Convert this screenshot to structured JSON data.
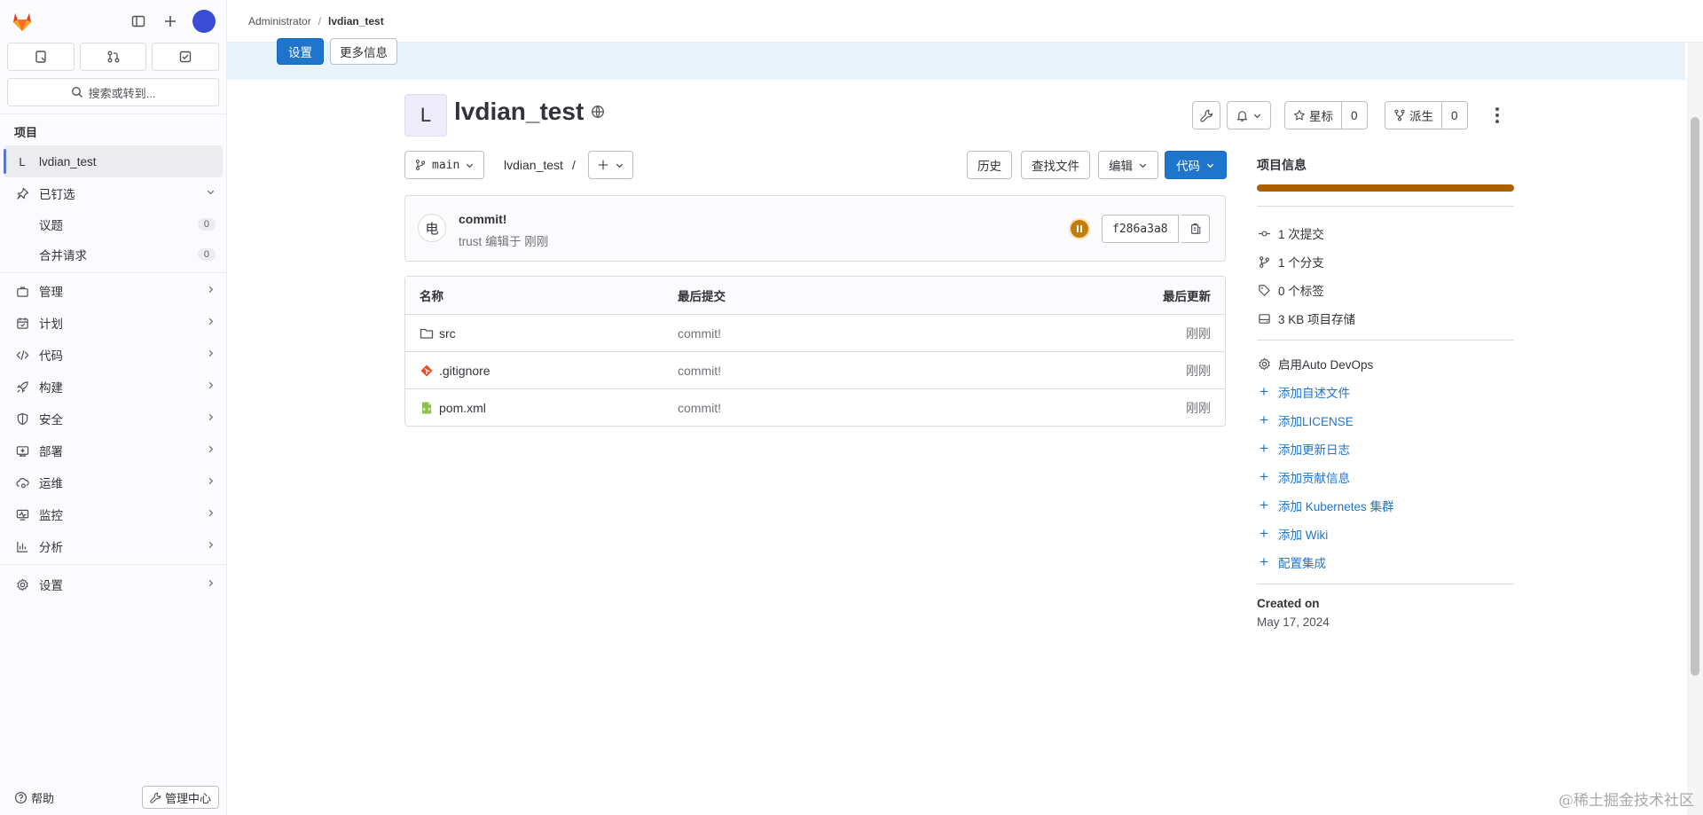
{
  "sidebar": {
    "search_placeholder": "搜索或转到...",
    "section_title": "项目",
    "project_letter": "L",
    "project_name": "lvdian_test",
    "pinned_label": "已钉选",
    "pinned_items": [
      {
        "label": "议题",
        "count": "0"
      },
      {
        "label": "合并请求",
        "count": "0"
      }
    ],
    "nav_items": [
      {
        "label": "管理",
        "icon": "briefcase-icon"
      },
      {
        "label": "计划",
        "icon": "calendar-icon"
      },
      {
        "label": "代码",
        "icon": "code-icon"
      },
      {
        "label": "构建",
        "icon": "rocket-icon"
      },
      {
        "label": "安全",
        "icon": "shield-icon"
      },
      {
        "label": "部署",
        "icon": "deployments-icon"
      },
      {
        "label": "运维",
        "icon": "cloud-gear-icon"
      },
      {
        "label": "监控",
        "icon": "monitor-icon"
      },
      {
        "label": "分析",
        "icon": "chart-icon"
      }
    ],
    "settings_label": "设置",
    "help_label": "帮助",
    "admin_label": "管理中心"
  },
  "breadcrumb": {
    "parent": "Administrator",
    "current": "lvdian_test"
  },
  "banner": {
    "settings_label": "设置",
    "more_info_label": "更多信息"
  },
  "project": {
    "avatar_letter": "L",
    "name": "lvdian_test",
    "notifications_icon": "bell-icon",
    "star_label": "星标",
    "star_count": "0",
    "fork_label": "派生",
    "fork_count": "0"
  },
  "repo": {
    "branch": "main",
    "path": "lvdian_test",
    "path_sep": "/",
    "history_label": "历史",
    "find_file_label": "查找文件",
    "edit_label": "编辑",
    "code_label": "代码"
  },
  "commit": {
    "avatar_text": "电",
    "title": "commit!",
    "meta": "trust 编辑于 刚刚",
    "sha": "f286a3a8",
    "status_color": "#c17d10"
  },
  "files": {
    "headers": {
      "name": "名称",
      "last_commit": "最后提交",
      "last_update": "最后更新"
    },
    "rows": [
      {
        "name": "src",
        "icon": "folder-icon",
        "commit": "commit!",
        "date": "刚刚"
      },
      {
        "name": ".gitignore",
        "icon": "git-icon",
        "commit": "commit!",
        "date": "刚刚"
      },
      {
        "name": "pom.xml",
        "icon": "xml-file-icon",
        "commit": "commit!",
        "date": "刚刚"
      }
    ]
  },
  "project_info": {
    "title": "项目信息",
    "bar_color": "#ab6100",
    "stats": [
      {
        "label": "1 次提交",
        "icon": "commit-icon"
      },
      {
        "label": "1 个分支",
        "icon": "branch-icon"
      },
      {
        "label": "0 个标签",
        "icon": "tag-icon"
      },
      {
        "label": "3 KB 项目存储",
        "icon": "storage-icon"
      }
    ],
    "devops_label": "启用Auto DevOps",
    "links": [
      "添加自述文件",
      "添加LICENSE",
      "添加更新日志",
      "添加贡献信息",
      "添加 Kubernetes 集群",
      "添加 Wiki",
      "配置集成"
    ],
    "created_label": "Created on",
    "created_value": "May 17, 2024"
  },
  "watermark": "@稀土掘金技术社区",
  "colors": {
    "primary": "#1f75cb",
    "sidebar_bg": "#fbfafd",
    "banner_bg": "#e9f3fc"
  }
}
